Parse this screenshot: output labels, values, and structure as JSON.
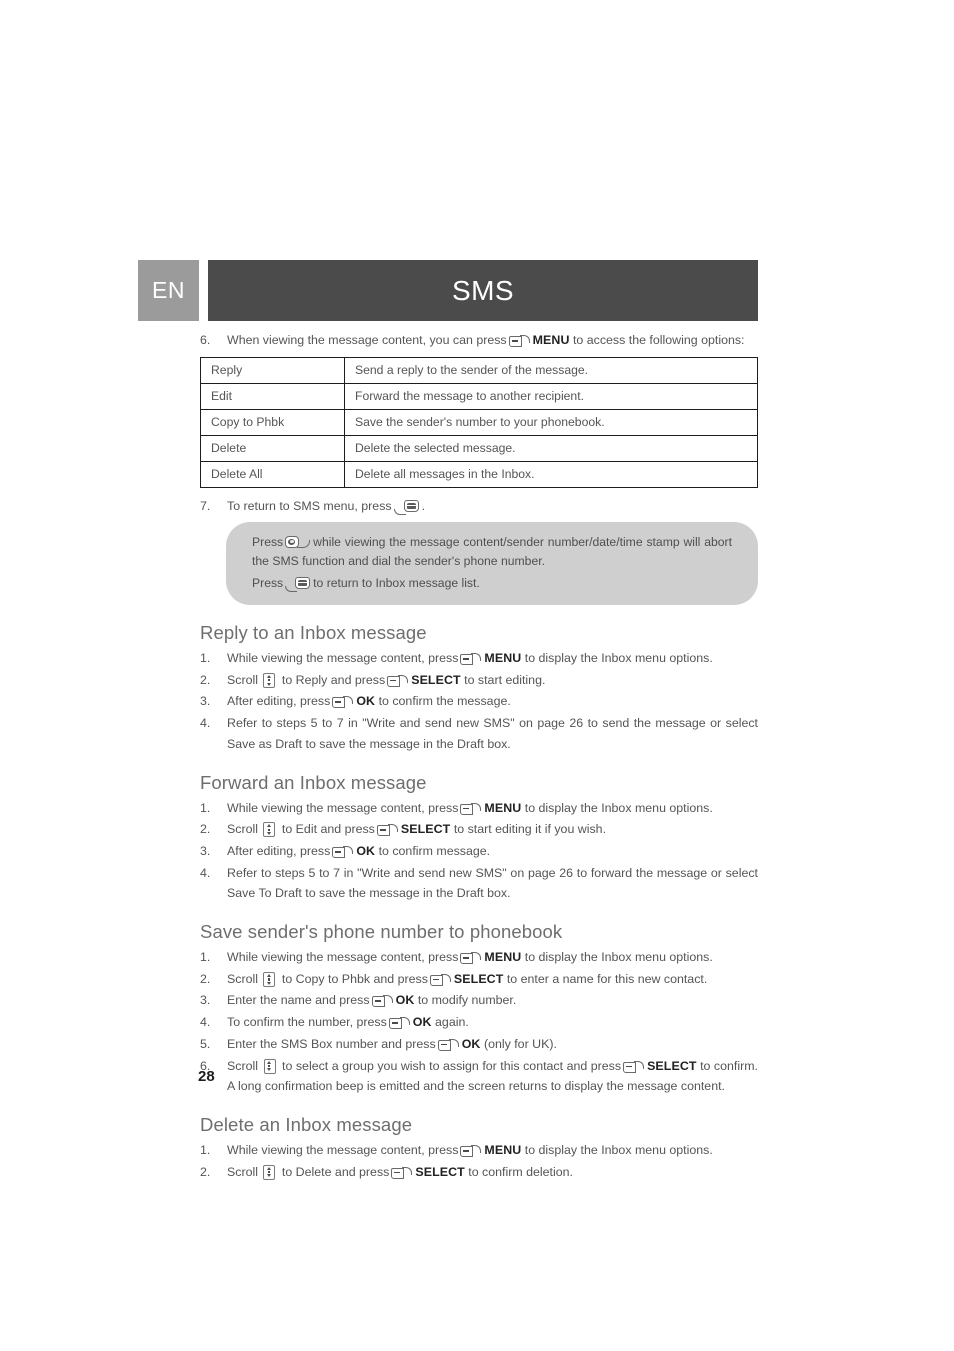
{
  "header": {
    "language_tab": "EN",
    "title": "SMS",
    "tab_color": "#9b9b9b",
    "bar_color": "#4b4b4b"
  },
  "intro_step": {
    "number": "6.",
    "text_before_key": "When viewing the message content, you can press",
    "key_icon": "soft-key-icon",
    "key_label": "MENU",
    "text_after_key": "to access the following options:"
  },
  "options_table": {
    "rows": [
      {
        "option": "Reply",
        "description": "Send a reply to the sender of the message."
      },
      {
        "option": "Edit",
        "description": "Forward the message to another recipient."
      },
      {
        "option": "Copy to Phbk",
        "description": "Save the sender's number to your phonebook."
      },
      {
        "option": "Delete",
        "description": "Delete the selected message."
      },
      {
        "option": "Delete All",
        "description": "Delete all messages in the Inbox."
      }
    ]
  },
  "step7": {
    "number": "7.",
    "text_before_key": "To return to SMS menu, press",
    "key_icon": "end-call-key-icon",
    "text_after_key": "."
  },
  "note": {
    "line1_a": "Press",
    "line1_icon": "talk-key-icon",
    "line1_b": "while viewing the message content/sender number/date/time stamp will abort the SMS function and dial the sender's phone number.",
    "line2_a": "Press",
    "line2_icon": "end-call-key-icon",
    "line2_b": "to return to Inbox message list."
  },
  "sections": [
    {
      "heading": "Reply to an Inbox message",
      "steps": [
        {
          "number": "1.",
          "a": "While viewing the message content, press",
          "icon": "soft-key-icon",
          "label": "MENU",
          "b": "to display the Inbox menu options."
        },
        {
          "number": "2.",
          "a": "Scroll",
          "icon": "scroll-key-icon",
          "mid": "to Reply and press",
          "icon2": "soft-key-icon",
          "label": "SELECT",
          "b": "to start editing."
        },
        {
          "number": "3.",
          "a": "After editing, press",
          "icon": "soft-key-icon",
          "label": "OK",
          "b": "to confirm the message."
        },
        {
          "number": "4.",
          "a": "Refer to steps 5 to 7 in \"Write and send new SMS\" on page 26 to send the message or select Save as Draft to save the message in the Draft box."
        }
      ]
    },
    {
      "heading": "Forward an Inbox message",
      "steps": [
        {
          "number": "1.",
          "a": "While viewing the message content, press",
          "icon": "soft-key-icon",
          "label": "MENU",
          "b": "to display the Inbox menu options."
        },
        {
          "number": "2.",
          "a": "Scroll",
          "icon": "scroll-key-icon",
          "mid": "to Edit and press",
          "icon2": "soft-key-icon",
          "label": "SELECT",
          "b": "to start editing it if you wish."
        },
        {
          "number": "3.",
          "a": "After editing, press",
          "icon": "soft-key-icon",
          "label": "OK",
          "b": "to confirm message."
        },
        {
          "number": "4.",
          "a": "Refer to steps 5 to 7 in \"Write and send new SMS\" on page 26 to forward the message or select Save To Draft to save the message in the Draft box."
        }
      ]
    },
    {
      "heading": "Save sender's phone number to phonebook",
      "steps": [
        {
          "number": "1.",
          "a": "While viewing the message content, press",
          "icon": "soft-key-icon",
          "label": "MENU",
          "b": "to display the Inbox menu options."
        },
        {
          "number": "2.",
          "a": "Scroll",
          "icon": "scroll-key-icon",
          "mid": "to Copy to Phbk and press",
          "icon2": "soft-key-icon",
          "label": "SELECT",
          "b": "to enter a name for this new contact."
        },
        {
          "number": "3.",
          "a": "Enter the name and press",
          "icon": "soft-key-icon",
          "label": "OK",
          "b": "to modify number."
        },
        {
          "number": "4.",
          "a": "To confirm the number, press",
          "icon": "soft-key-icon",
          "label": "OK",
          "b": "again."
        },
        {
          "number": "5.",
          "a": "Enter the SMS Box number and press",
          "icon": "soft-key-icon",
          "label": "OK",
          "b": "(only for UK)."
        },
        {
          "number": "6.",
          "a": "Scroll",
          "icon": "scroll-key-icon",
          "mid": "to select a group you wish to assign for this contact and press",
          "icon2": "soft-key-icon",
          "label": "SELECT",
          "b": "to confirm. A long confirmation beep is emitted and the screen returns to display the message content."
        }
      ]
    },
    {
      "heading": "Delete an Inbox message",
      "steps": [
        {
          "number": "1.",
          "a": "While viewing the message content, press",
          "icon": "soft-key-icon",
          "label": "MENU",
          "b": "to display the Inbox menu options."
        },
        {
          "number": "2.",
          "a": "Scroll",
          "icon": "scroll-key-icon",
          "mid": "to Delete and press",
          "icon2": "soft-key-icon",
          "label": "SELECT",
          "b": "to confirm deletion."
        }
      ]
    }
  ],
  "page_number": "28"
}
